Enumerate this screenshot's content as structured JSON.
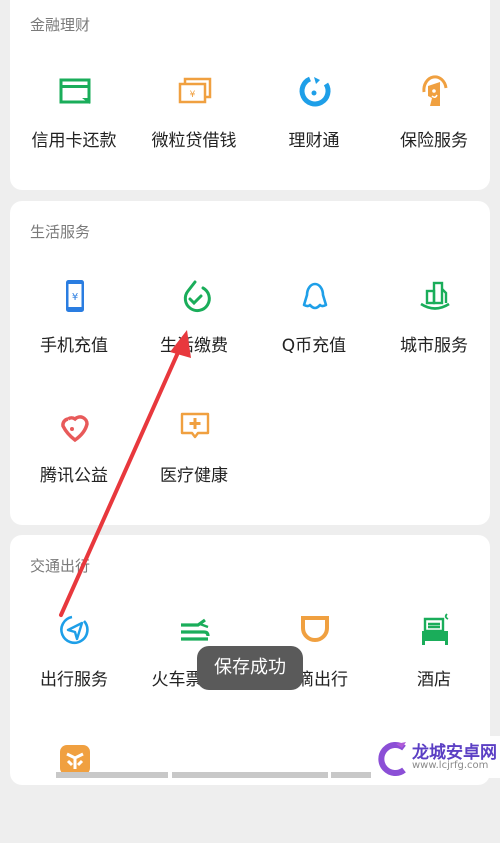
{
  "sections": [
    {
      "title": "金融理财",
      "items": [
        {
          "label": "信用卡还款",
          "icon": "credit-card-icon",
          "color": "#1aad5a"
        },
        {
          "label": "微粒贷借钱",
          "icon": "banknote-icon",
          "color": "#f0a040"
        },
        {
          "label": "理财通",
          "icon": "wealth-icon",
          "color": "#1e9fe8"
        },
        {
          "label": "保险服务",
          "icon": "insurance-icon",
          "color": "#f0a040"
        }
      ]
    },
    {
      "title": "生活服务",
      "items": [
        {
          "label": "手机充值",
          "icon": "phone-recharge-icon",
          "color": "#2a7de1"
        },
        {
          "label": "生活缴费",
          "icon": "bill-payment-icon",
          "color": "#1aad5a"
        },
        {
          "label": "Q币充值",
          "icon": "qq-penguin-icon",
          "color": "#1e9fe8"
        },
        {
          "label": "城市服务",
          "icon": "city-icon",
          "color": "#1aad5a"
        },
        {
          "label": "腾讯公益",
          "icon": "charity-heart-icon",
          "color": "#e85a5a"
        },
        {
          "label": "医疗健康",
          "icon": "medical-icon",
          "color": "#f0a040"
        }
      ]
    },
    {
      "title": "交通出行",
      "items": [
        {
          "label": "出行服务",
          "icon": "navigation-icon",
          "color": "#1e9fe8"
        },
        {
          "label": "火车票机票",
          "icon": "train-icon",
          "color": "#1aad5a"
        },
        {
          "label": "滴滴出行",
          "icon": "didi-icon",
          "color": "#f0a040"
        },
        {
          "label": "酒店",
          "icon": "hotel-bed-icon",
          "color": "#1aad5a"
        },
        {
          "label": "",
          "icon": "shopping-icon",
          "color": "#f0a040"
        }
      ]
    }
  ],
  "toast": {
    "text": "保存成功"
  },
  "annotation": {
    "type": "arrow",
    "color": "#e8383d",
    "points_to": "生活缴费"
  },
  "watermark": {
    "title": "龙城安卓网",
    "url": "www.lcjrfg.com"
  }
}
